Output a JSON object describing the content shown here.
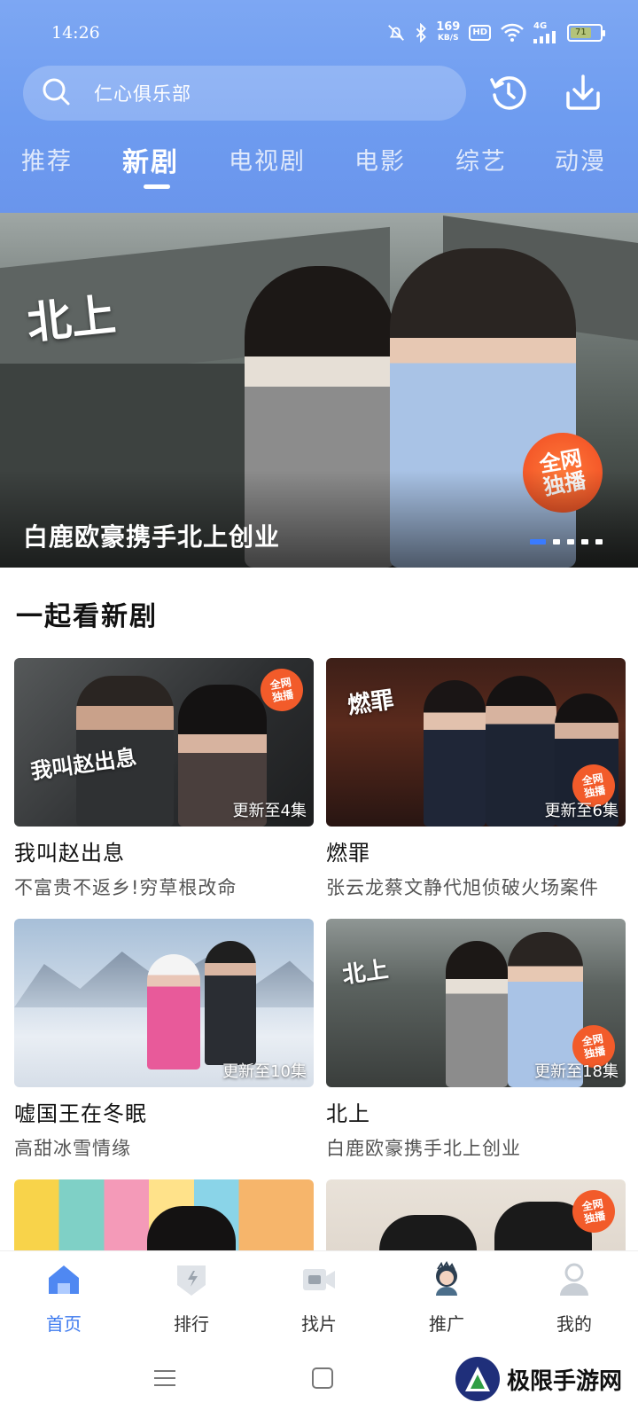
{
  "status_bar": {
    "time": "14:26",
    "net_speed_value": "169",
    "net_speed_unit": "KB/S",
    "hd_label": "HD",
    "network_label": "4G",
    "battery_level": "71"
  },
  "search": {
    "text": "仁心俱乐部"
  },
  "tabs": [
    {
      "label": "推荐"
    },
    {
      "label": "新剧"
    },
    {
      "label": "电视剧"
    },
    {
      "label": "电影"
    },
    {
      "label": "综艺"
    },
    {
      "label": "动漫"
    }
  ],
  "active_tab": "新剧",
  "banner": {
    "logo_text": "北上",
    "badge_line1": "全网",
    "badge_line2": "独播",
    "caption": "白鹿欧豪携手北上创业"
  },
  "section": {
    "title": "一起看新剧"
  },
  "cards": [
    {
      "title": "我叫赵出息",
      "subtitle": "不富贵不返乡!穷草根改命",
      "episode": "更新至4集",
      "logo": "我叫赵出息",
      "badge1": "全网",
      "badge2": "独播"
    },
    {
      "title": "燃罪",
      "subtitle": "张云龙蔡文静代旭侦破火场案件",
      "episode": "更新至6集",
      "logo": "燃罪",
      "badge1": "全网",
      "badge2": "独播"
    },
    {
      "title": "嘘国王在冬眠",
      "subtitle": "高甜冰雪情缘",
      "episode": "更新至10集"
    },
    {
      "title": "北上",
      "subtitle": "白鹿欧豪携手北上创业",
      "episode": "更新至18集",
      "logo": "北上",
      "badge1": "全网",
      "badge2": "独播"
    },
    {
      "title": "",
      "subtitle": "",
      "episode": ""
    },
    {
      "title": "",
      "subtitle": "",
      "episode": "",
      "badge1": "全网",
      "badge2": "独播"
    }
  ],
  "bottom_nav": [
    {
      "label": "首页",
      "icon": "home-icon"
    },
    {
      "label": "排行",
      "icon": "ranking-icon"
    },
    {
      "label": "找片",
      "icon": "video-camera-icon"
    },
    {
      "label": "推广",
      "icon": "promo-avatar-icon"
    },
    {
      "label": "我的",
      "icon": "user-icon"
    }
  ],
  "watermark": {
    "text": "极限手游网"
  },
  "colors": {
    "accent": "#3f7bef",
    "header": "#6e9cf0",
    "badge": "#f25b2a"
  }
}
